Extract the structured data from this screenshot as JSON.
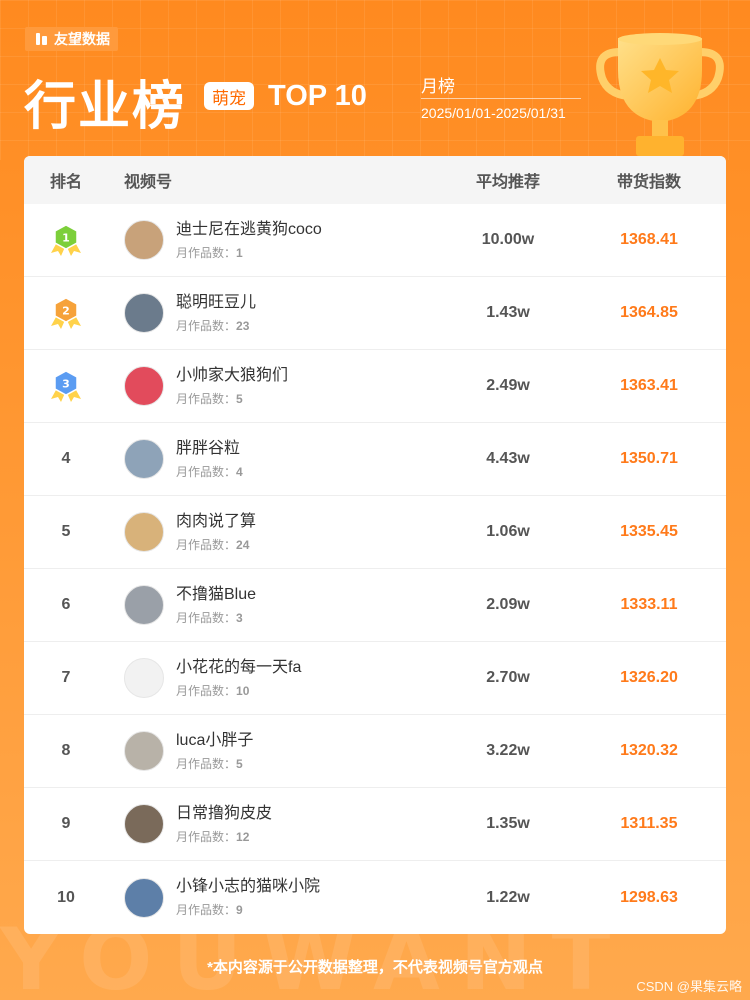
{
  "brand": {
    "name": "友望数据"
  },
  "header": {
    "title": "行业榜",
    "category": "萌宠",
    "top_label": "TOP 10",
    "period_label": "月榜",
    "period_range": "2025/01/01-2025/01/31"
  },
  "table": {
    "headers": {
      "rank": "排名",
      "name": "视频号",
      "avg": "平均推荐",
      "index": "带货指数"
    },
    "works_label": "月作品数：",
    "rows": [
      {
        "rank": "1",
        "name": "迪士尼在逃黄狗coco",
        "works": "1",
        "avg": "10.00w",
        "index": "1368.41",
        "medal": "green"
      },
      {
        "rank": "2",
        "name": "聪明旺豆儿",
        "works": "23",
        "avg": "1.43w",
        "index": "1364.85",
        "medal": "orange"
      },
      {
        "rank": "3",
        "name": "小帅家大狼狗们",
        "works": "5",
        "avg": "2.49w",
        "index": "1363.41",
        "medal": "blue"
      },
      {
        "rank": "4",
        "name": "胖胖谷粒",
        "works": "4",
        "avg": "4.43w",
        "index": "1350.71"
      },
      {
        "rank": "5",
        "name": "肉肉说了算",
        "works": "24",
        "avg": "1.06w",
        "index": "1335.45"
      },
      {
        "rank": "6",
        "name": "不撸猫Blue",
        "works": "3",
        "avg": "2.09w",
        "index": "1333.11"
      },
      {
        "rank": "7",
        "name": "小花花的每一天fa",
        "works": "10",
        "avg": "2.70w",
        "index": "1326.20"
      },
      {
        "rank": "8",
        "name": "luca小胖子",
        "works": "5",
        "avg": "3.22w",
        "index": "1320.32"
      },
      {
        "rank": "9",
        "name": "日常撸狗皮皮",
        "works": "12",
        "avg": "1.35w",
        "index": "1311.35"
      },
      {
        "rank": "10",
        "name": "小锋小志的猫咪小院",
        "works": "9",
        "avg": "1.22w",
        "index": "1298.63"
      }
    ]
  },
  "footer": {
    "note": "*本内容源于公开数据整理，不代表视频号官方观点",
    "credit": "CSDN @果集云略",
    "watermark": "YOUWANT"
  },
  "colors": {
    "accent": "#ff7a1a",
    "background": "#ff8a1f",
    "medal_green": "#7ccf3a",
    "medal_orange": "#f6a23a",
    "medal_blue": "#5b9cf2"
  }
}
